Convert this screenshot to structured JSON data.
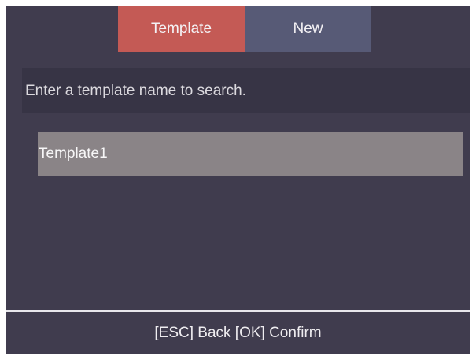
{
  "tabs": [
    {
      "label": "Template",
      "active": true
    },
    {
      "label": "New",
      "active": false
    }
  ],
  "search": {
    "placeholder": "Enter a template name to search."
  },
  "list": {
    "items": [
      {
        "label": "Template1",
        "selected": true
      }
    ]
  },
  "footer": {
    "hint": "[ESC] Back [OK] Confirm"
  },
  "colors": {
    "background": "#403c4e",
    "active_tab": "#c45a55",
    "inactive_tab": "#575a76",
    "search_bar": "#373445",
    "selected_item": "#8a8487"
  }
}
